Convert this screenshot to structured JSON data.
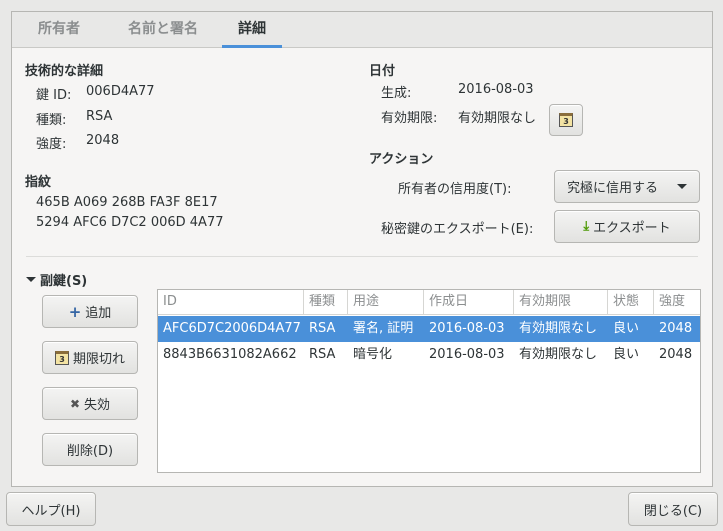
{
  "tabs": [
    {
      "label": "所有者",
      "active": false
    },
    {
      "label": "名前と署名",
      "active": false
    },
    {
      "label": "詳細",
      "active": true
    }
  ],
  "tech": {
    "heading": "技術的な詳細",
    "key_id_label": "鍵 ID:",
    "key_id_value": "006D4A77",
    "type_label": "種類:",
    "type_value": "RSA",
    "strength_label": "強度:",
    "strength_value": "2048"
  },
  "fingerprint": {
    "heading": "指紋",
    "line1": "465B A069 268B FA3F 8E17",
    "line2": "5294 AFC6 D7C2 006D 4A77"
  },
  "dates": {
    "heading": "日付",
    "created_label": "生成:",
    "created_value": "2016-08-03",
    "expires_label": "有効期限:",
    "expires_value": "有効期限なし"
  },
  "actions": {
    "heading": "アクション",
    "trust_label": "所有者の信用度(T):",
    "trust_value": "究極に信用する",
    "export_label": "秘密鍵のエクスポート(E):",
    "export_button": "エクスポート"
  },
  "subkeys": {
    "heading": "副鍵(S)",
    "add_button": "追加",
    "expire_button": "期限切れ",
    "revoke_button": "失効",
    "delete_button": "削除(D)",
    "columns": [
      "ID",
      "種類",
      "用途",
      "作成日",
      "有効期限",
      "状態",
      "強度"
    ],
    "rows": [
      {
        "id": "AFC6D7C2006D4A77",
        "type": "RSA",
        "usage": "署名, 証明",
        "created": "2016-08-03",
        "expires": "有効期限なし",
        "status": "良い",
        "strength": "2048",
        "selected": true
      },
      {
        "id": "8843B6631082A662",
        "type": "RSA",
        "usage": "暗号化",
        "created": "2016-08-03",
        "expires": "有効期限なし",
        "status": "良い",
        "strength": "2048",
        "selected": false
      }
    ]
  },
  "footer": {
    "help_button": "ヘルプ(H)",
    "close_button": "閉じる(C)"
  },
  "colors": {
    "accent": "#4a90d9",
    "background": "#f6f5f4"
  },
  "icons": [
    "calendar-icon",
    "plus-icon",
    "x-icon",
    "download-icon",
    "chevron-down-icon",
    "expander-icon"
  ]
}
